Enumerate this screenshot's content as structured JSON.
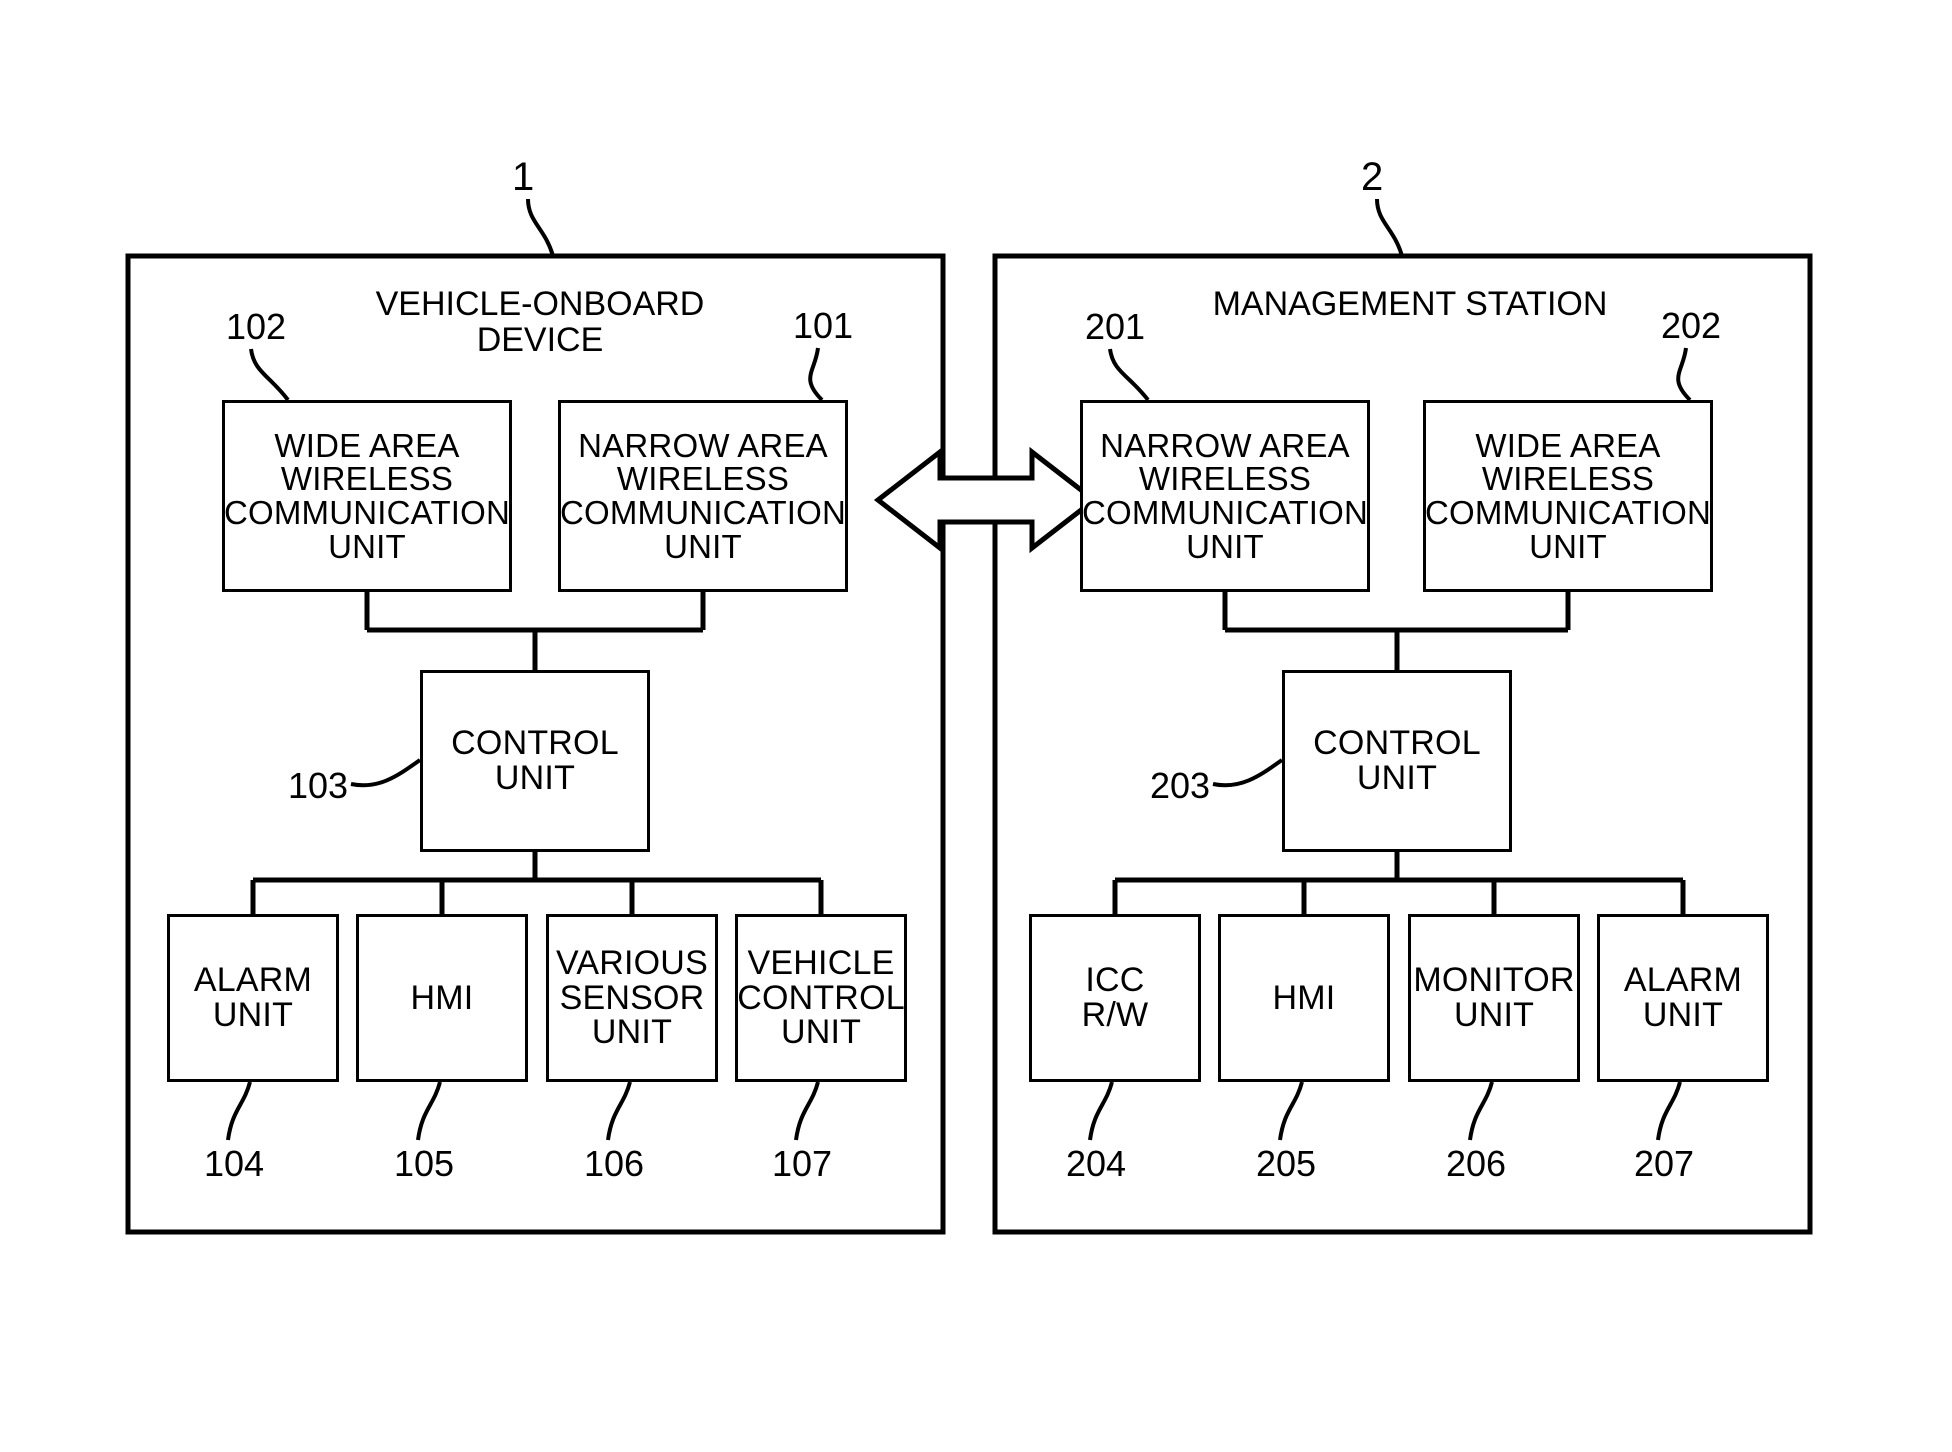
{
  "figure": {
    "type": "patent-block-diagram",
    "background_color": "#ffffff",
    "line_color": "#000000"
  },
  "panels": [
    {
      "id": "vehicle-onboard-device",
      "ref": "1",
      "title": "VEHICLE-ONBOARD\nDEVICE"
    },
    {
      "id": "management-station",
      "ref": "2",
      "title": "MANAGEMENT STATION"
    }
  ],
  "left_panel": {
    "ref_label": "1",
    "title": "VEHICLE-ONBOARD\nDEVICE",
    "comm_units": [
      {
        "ref": "102",
        "label": "WIDE AREA\nWIRELESS\nCOMMUNICATION\nUNIT"
      },
      {
        "ref": "101",
        "label": "NARROW AREA\nWIRELESS\nCOMMUNICATION\nUNIT"
      }
    ],
    "control_unit": {
      "ref": "103",
      "label": "CONTROL\nUNIT"
    },
    "peripherals": [
      {
        "ref": "104",
        "label": "ALARM\nUNIT"
      },
      {
        "ref": "105",
        "label": "HMI"
      },
      {
        "ref": "106",
        "label": "VARIOUS\nSENSOR\nUNIT"
      },
      {
        "ref": "107",
        "label": "VEHICLE\nCONTROL\nUNIT"
      }
    ]
  },
  "right_panel": {
    "ref_label": "2",
    "title": "MANAGEMENT STATION",
    "comm_units": [
      {
        "ref": "201",
        "label": "NARROW AREA\nWIRELESS\nCOMMUNICATION\nUNIT"
      },
      {
        "ref": "202",
        "label": "WIDE AREA\nWIRELESS\nCOMMUNICATION\nUNIT"
      }
    ],
    "control_unit": {
      "ref": "203",
      "label": "CONTROL\nUNIT"
    },
    "peripherals": [
      {
        "ref": "204",
        "label": "ICC\nR/W"
      },
      {
        "ref": "205",
        "label": "HMI"
      },
      {
        "ref": "206",
        "label": "MONITOR\nUNIT"
      },
      {
        "ref": "207",
        "label": "ALARM\nUNIT"
      }
    ]
  },
  "link": {
    "name": "bidirectional-wireless-link",
    "icon": "double-headed-arrow"
  }
}
